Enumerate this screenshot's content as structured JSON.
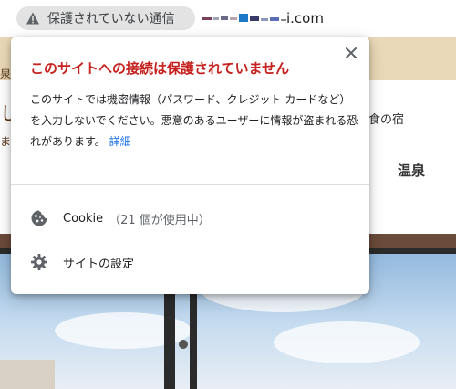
{
  "address_bar": {
    "security_label": "保護されていない通信",
    "url_visible_tail": "i.com"
  },
  "page_background": {
    "tagline": "食の宿",
    "nav_item": "温泉"
  },
  "popup": {
    "title": "このサイトへの接続は保護されていません",
    "description": "このサイトでは機密情報（パスワード、クレジット カードなど）を入力しないでください。悪意のあるユーザーに情報が盗まれる恐れがあります。",
    "details_link": "詳細",
    "cookie_label": "Cookie",
    "cookie_count": "（21 個が使用中）",
    "site_settings_label": "サイトの設定"
  },
  "colors": {
    "warning_title": "#c5221f",
    "link": "#1a73e8",
    "chip_background": "#e3e3e3"
  },
  "icons": {
    "security": "warning-triangle-icon",
    "close": "close-icon",
    "cookie": "cookie-icon",
    "settings": "gear-icon"
  }
}
